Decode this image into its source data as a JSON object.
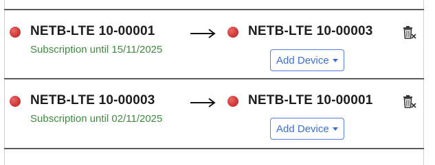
{
  "rows": [
    {
      "source": {
        "name": "NETB-LTE 10-00001",
        "subscription": "Subscription until 15/11/2025",
        "status_color": "#d23a3a"
      },
      "target": {
        "name": "NETB-LTE 10-00003",
        "status_color": "#d23a3a"
      },
      "add_device_label": "Add Device",
      "arrow_icon": "arrow-right-icon",
      "delete_icon": "trash-x-icon"
    },
    {
      "source": {
        "name": "NETB-LTE 10-00003",
        "subscription": "Subscription until 02/11/2025",
        "status_color": "#d23a3a"
      },
      "target": {
        "name": "NETB-LTE 10-00001",
        "status_color": "#d23a3a"
      },
      "add_device_label": "Add Device",
      "arrow_icon": "arrow-right-icon",
      "delete_icon": "trash-x-icon"
    }
  ],
  "colors": {
    "subscription_text": "#3f8a3f",
    "button_accent": "#3a6fd0",
    "status_red": "#d23a3a"
  }
}
